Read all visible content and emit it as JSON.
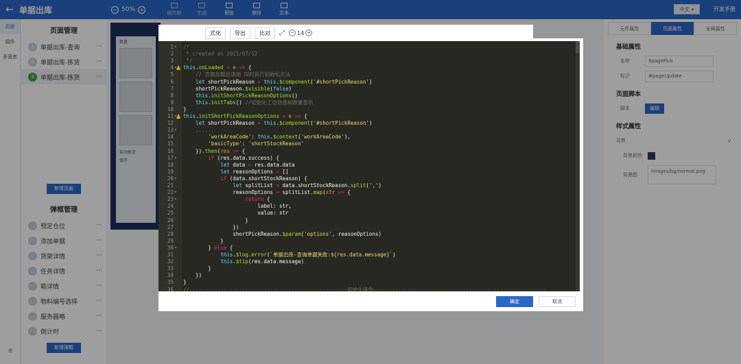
{
  "topbar": {
    "title": "单据出库",
    "zoom": "50%",
    "tools": [
      "组件树",
      "生成",
      "预览",
      "保存",
      "文本"
    ],
    "lang": "中文",
    "dev": "开发手册"
  },
  "rail": {
    "items": [
      "页面",
      "组件",
      "多语言"
    ],
    "footer": "☰"
  },
  "left": {
    "page_section": "页面管理",
    "pages": [
      {
        "num": "1",
        "label": "单据出库-查询"
      },
      {
        "num": "2",
        "label": "单据出库-拣货"
      },
      {
        "num": "3",
        "label": "单据出库-拣货"
      }
    ],
    "add_page": "新增页面",
    "popup_section": "弹框管理",
    "popups": [
      "预定仓位",
      "添加单据",
      "货架详情",
      "任务详情",
      "箱详情",
      "物料编号选择",
      "服务器略",
      "倒计时"
    ],
    "add_popup": "新增弹框",
    "canvas_labels": [
      "数量",
      "自动拣货",
      "保存"
    ]
  },
  "toolbar2": {
    "format": "式化",
    "export": "导出",
    "compare": "比对",
    "font_size": "14"
  },
  "editor": {
    "lines": [
      {
        "n": "1",
        "fold": "▾",
        "warn": false,
        "html": "<span class='c-cm'>/*</span>"
      },
      {
        "n": "2",
        "fold": "",
        "warn": false,
        "html": "<span class='c-cm'> * created on 2021/07/12</span>"
      },
      {
        "n": "3",
        "fold": "",
        "warn": false,
        "html": "<span class='c-cm'> */</span>"
      },
      {
        "n": "4",
        "fold": "▾",
        "warn": true,
        "html": "<span class='c-th'>this</span>.<span class='c-fn'>onLoaded</span> <span class='c-kw'>=</span> <span class='c-at'>e</span> <span class='c-kw'>=&gt;</span> {"
      },
      {
        "n": "5",
        "fold": "",
        "warn": false,
        "html": "    <span class='c-cm'>// 页面加载后调用 同时执行初始化方法</span>"
      },
      {
        "n": "6",
        "fold": "",
        "warn": false,
        "html": "    <span class='c-th'>let</span> shortPickReason <span class='c-kw'>=</span> <span class='c-th'>this</span>.<span class='c-fn'>$component</span>(<span class='c-st'>'#shortPickReason'</span>)"
      },
      {
        "n": "7",
        "fold": "",
        "warn": false,
        "html": "    shortPickReason.<span class='c-fn'>$visible</span>(<span class='c-th'>false</span>)"
      },
      {
        "n": "8",
        "fold": "",
        "warn": false,
        "html": "    <span class='c-th'>this</span>.<span class='c-fn'>initShortPickReasonOptions</span>()"
      },
      {
        "n": "9",
        "fold": "",
        "warn": false,
        "html": "    <span class='c-th'>this</span>.<span class='c-fn'>initTabs</span>() <span class='c-cm'>//初始化工位信息和数量显示</span>"
      },
      {
        "n": "10",
        "fold": "",
        "warn": false,
        "html": "}"
      },
      {
        "n": "11",
        "fold": "▾",
        "warn": true,
        "html": "<span class='c-th'>this</span>.<span class='c-fn'>initShortPickReasonOptions</span> <span class='c-kw'>=</span> <span class='c-at'>e</span> <span class='c-kw'>=&gt;</span> {"
      },
      {
        "n": "12",
        "fold": "",
        "warn": false,
        "html": "    <span class='c-th'>let</span> shortPickReason <span class='c-kw'>=</span> <span class='c-th'>this</span>.<span class='c-fn'>$component</span>(<span class='c-st'>'#shortPickReason'</span>)"
      },
      {
        "n": "13",
        "fold": "▾",
        "warn": false,
        "html": "    <span class='c-cm'>......</span>"
      },
      {
        "n": "14",
        "fold": "",
        "warn": false,
        "html": "        <span class='c-st'>'workAreaCode'</span>: <span class='c-th'>this</span>.<span class='c-fn'>$context</span>(<span class='c-st'>'workAreaCode'</span>),"
      },
      {
        "n": "15",
        "fold": "",
        "warn": false,
        "html": "        <span class='c-st'>'basicType'</span>: <span class='c-st'>'shortStockReason'</span>"
      },
      {
        "n": "16",
        "fold": "",
        "warn": false,
        "html": "    }).<span class='c-fn'>then</span>(<span class='c-at'>res</span> <span class='c-kw'>=&gt;</span> {"
      },
      {
        "n": "17",
        "fold": "▾",
        "warn": false,
        "html": "        <span class='c-kw'>if</span> (res.data.success) {"
      },
      {
        "n": "18",
        "fold": "",
        "warn": false,
        "html": "            <span class='c-th'>let</span> data <span class='c-kw'>=</span> res.data.data"
      },
      {
        "n": "19",
        "fold": "",
        "warn": false,
        "html": "            <span class='c-th'>let</span> reasonOptions <span class='c-kw'>=</span> []"
      },
      {
        "n": "20",
        "fold": "▾",
        "warn": false,
        "html": "            <span class='c-kw'>if</span> (data.shortStockReason) {"
      },
      {
        "n": "21",
        "fold": "",
        "warn": false,
        "html": "                <span class='c-th'>let</span> splitList <span class='c-kw'>=</span> data.shortStockReason.<span class='c-fn'>split</span>(<span class='c-st'>','</span>)"
      },
      {
        "n": "22",
        "fold": "▾",
        "warn": false,
        "html": "                reasonOptions <span class='c-kw'>=</span> splitList.<span class='c-fn'>map</span>(<span class='c-at'>str</span> <span class='c-kw'>=&gt;</span> {"
      },
      {
        "n": "23",
        "fold": "▾",
        "warn": false,
        "html": "                    <span class='c-kw'>return</span> {"
      },
      {
        "n": "24",
        "fold": "",
        "warn": false,
        "html": "                        label: str,"
      },
      {
        "n": "25",
        "fold": "",
        "warn": false,
        "html": "                        value: str"
      },
      {
        "n": "26",
        "fold": "",
        "warn": false,
        "html": "                    }"
      },
      {
        "n": "27",
        "fold": "",
        "warn": false,
        "html": "                })"
      },
      {
        "n": "28",
        "fold": "",
        "warn": false,
        "html": "                shortPickReason.<span class='c-fn'>$param</span>(<span class='c-st'>'options'</span>, reasonOptions)"
      },
      {
        "n": "29",
        "fold": "",
        "warn": false,
        "html": "            }"
      },
      {
        "n": "30",
        "fold": "▾",
        "warn": false,
        "html": "        } <span class='c-kw'>else</span> {"
      },
      {
        "n": "31",
        "fold": "",
        "warn": false,
        "html": "            <span class='c-th'>this</span>.<span class='c-fn'>$log</span>.<span class='c-fn'>error</span>(<span class='c-st'>`单据出库-查询单据失败:${res.data.message}`</span>)"
      },
      {
        "n": "32",
        "fold": "",
        "warn": false,
        "html": "            <span class='c-th'>this</span>.<span class='c-fn'>$tip</span>(res.data.message)"
      },
      {
        "n": "33",
        "fold": "",
        "warn": false,
        "html": "        }"
      },
      {
        "n": "34",
        "fold": "",
        "warn": false,
        "html": "    })"
      },
      {
        "n": "35",
        "fold": "",
        "warn": false,
        "html": "}"
      },
      {
        "n": "36",
        "fold": "",
        "warn": false,
        "html": "<span class='c-cm'>//---------------------------------------------------初始化操作--------------------------------------------------------</span>"
      }
    ]
  },
  "footer": {
    "ok": "确定",
    "cancel": "取消"
  },
  "right": {
    "tabs": [
      "元件属性",
      "页面属性",
      "全局属性"
    ],
    "basic_section": "基础属性",
    "name_label": "名称",
    "name_value": "$pagePick",
    "id_label": "标识",
    "id_value": "#pageUpdate",
    "script_section": "页面脚本",
    "script_label": "脚本",
    "script_btn": "编辑",
    "style_section": "样式属性",
    "bg_label": "背景",
    "bgcolor_label": "背景颜色",
    "bgimg_label": "背景图",
    "bgimg_value": "images/bg/normal.png"
  }
}
